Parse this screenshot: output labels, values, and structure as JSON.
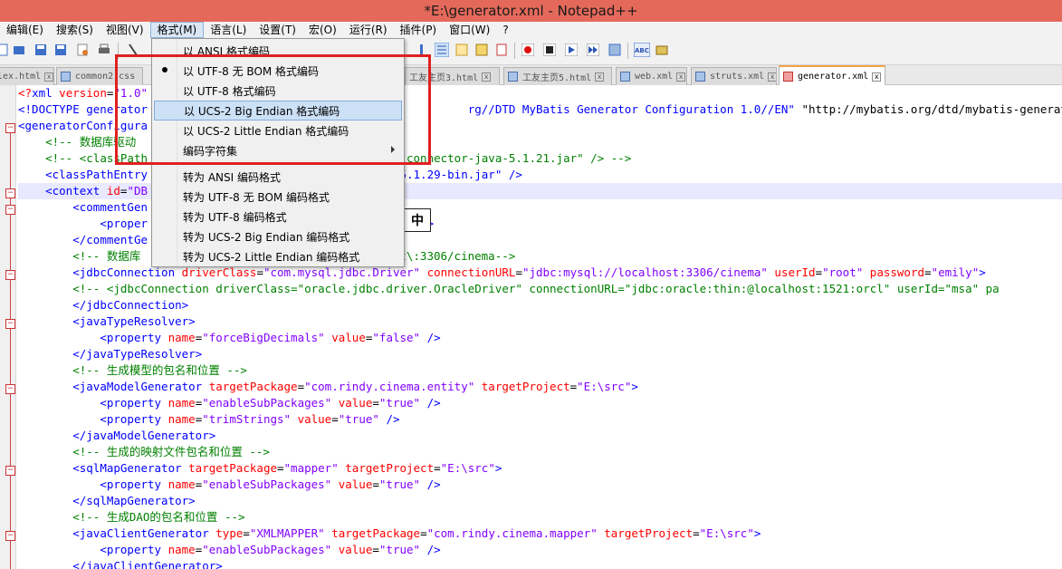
{
  "window": {
    "title": "*E:\\generator.xml - Notepad++"
  },
  "menubar": {
    "items": [
      "编辑(E)",
      "搜索(S)",
      "视图(V)",
      "格式(M)",
      "语言(L)",
      "设置(T)",
      "宏(O)",
      "运行(R)",
      "插件(P)",
      "窗口(W)",
      "?"
    ]
  },
  "tabs": [
    {
      "label": "lex.html",
      "active": false
    },
    {
      "label": "common2.css",
      "active": false
    },
    {
      "label": "工友主页3.html",
      "active": false
    },
    {
      "label": "工友主页5.html",
      "active": false
    },
    {
      "label": "web.xml",
      "active": false
    },
    {
      "label": "struts.xml",
      "active": false
    },
    {
      "label": "generator.xml",
      "active": true
    }
  ],
  "format_menu": {
    "items": [
      {
        "label": "以 ANSI 格式编码",
        "checked": false
      },
      {
        "label": "以 UTF-8 无 BOM 格式编码",
        "checked": true
      },
      {
        "label": "以 UTF-8 格式编码",
        "checked": false
      },
      {
        "label": "以 UCS-2 Big Endian 格式编码",
        "checked": false,
        "highlighted": true
      },
      {
        "label": "以 UCS-2 Little Endian 格式编码",
        "checked": false
      },
      {
        "label": "编码字符集",
        "submenu": true
      },
      {
        "label": "转为 ANSI 编码格式"
      },
      {
        "label": "转为 UTF-8 无 BOM 编码格式"
      },
      {
        "label": "转为 UTF-8 编码格式"
      },
      {
        "label": "转为 UCS-2 Big Endian 编码格式"
      },
      {
        "label": "转为 UCS-2 Little Endian 编码格式"
      }
    ]
  },
  "ime_indicator": "中",
  "code_lines": [
    [
      [
        "pi",
        "<?"
      ],
      [
        "tag",
        "xml "
      ],
      [
        "attr",
        "version"
      ],
      [
        "txt",
        "="
      ],
      [
        "val",
        "\"1.0\""
      ]
    ],
    [
      [
        "tag",
        "<!DOCTYPE generator"
      ],
      [
        "txt",
        "                                               "
      ],
      [
        "tag",
        "rg//DTD MyBatis Generator Configuration 1.0//EN\" "
      ],
      [
        "txt",
        "\"http://mybatis.org/dtd/mybatis-generator-"
      ]
    ],
    [
      [
        "tag",
        "<generatorConfigura"
      ]
    ],
    [
      [
        "txt",
        "    "
      ],
      [
        "cmt",
        "<!-- 数据库驱动"
      ]
    ],
    [
      [
        "txt",
        "    "
      ],
      [
        "cmt",
        "<!-- <classPath"
      ],
      [
        "txt",
        "                                    "
      ],
      [
        "cmt",
        "l-connector-java-5.1.21.jar\" /> -->"
      ]
    ],
    [
      [
        "txt",
        "    "
      ],
      [
        "tag",
        "<classPathEntry"
      ],
      [
        "txt",
        "                                    "
      ],
      [
        "tag",
        "-5.1.29-bin.jar\" />"
      ]
    ],
    [
      [
        "txt",
        "    "
      ],
      [
        "tag",
        "<context "
      ],
      [
        "attr",
        "id"
      ],
      [
        "txt",
        "="
      ],
      [
        "val",
        "\"DB"
      ]
    ],
    [
      [
        "txt",
        "        "
      ],
      [
        "tag",
        "<commentGen"
      ]
    ],
    [
      [
        "txt",
        "            "
      ],
      [
        "tag",
        "<proper"
      ],
      [
        "txt",
        "                                   "
      ],
      [
        "val",
        "rue\" "
      ],
      [
        "tag",
        "/>"
      ]
    ],
    [
      [
        "txt",
        "        "
      ],
      [
        "tag",
        "</commentGe"
      ]
    ],
    [
      [
        "txt",
        "        "
      ],
      [
        "cmt",
        "<!-- 数据库"
      ],
      [
        "txt",
        "                          "
      ],
      [
        "cmt",
        "\\://localhost\\:3306/cinema-->"
      ]
    ],
    [
      [
        "txt",
        "        "
      ],
      [
        "tag",
        "<jdbcConnection "
      ],
      [
        "attr",
        "driverClass"
      ],
      [
        "txt",
        "="
      ],
      [
        "val",
        "\"com.mysql.jdbc.Driver\" "
      ],
      [
        "attr",
        "connectionURL"
      ],
      [
        "txt",
        "="
      ],
      [
        "val",
        "\"jdbc:mysql://localhost:3306/cinema\" "
      ],
      [
        "attr",
        "userId"
      ],
      [
        "txt",
        "="
      ],
      [
        "val",
        "\"root\" "
      ],
      [
        "attr",
        "password"
      ],
      [
        "txt",
        "="
      ],
      [
        "val",
        "\"emily\""
      ],
      [
        "tag",
        ">"
      ]
    ],
    [
      [
        "txt",
        "        "
      ],
      [
        "cmt",
        "<!-- <jdbcConnection driverClass=\"oracle.jdbc.driver.OracleDriver\" connectionURL=\"jdbc:oracle:thin:@localhost:1521:orcl\" userId=\"msa\" pa"
      ]
    ],
    [
      [
        "txt",
        "        "
      ],
      [
        "tag",
        "</jdbcConnection>"
      ]
    ],
    [
      [
        "txt",
        "        "
      ],
      [
        "tag",
        "<javaTypeResolver>"
      ]
    ],
    [
      [
        "txt",
        "            "
      ],
      [
        "tag",
        "<property "
      ],
      [
        "attr",
        "name"
      ],
      [
        "txt",
        "="
      ],
      [
        "val",
        "\"forceBigDecimals\" "
      ],
      [
        "attr",
        "value"
      ],
      [
        "txt",
        "="
      ],
      [
        "val",
        "\"false\" "
      ],
      [
        "tag",
        "/>"
      ]
    ],
    [
      [
        "txt",
        "        "
      ],
      [
        "tag",
        "</javaTypeResolver>"
      ]
    ],
    [
      [
        "txt",
        "        "
      ],
      [
        "cmt",
        "<!-- 生成模型的包名和位置 -->"
      ]
    ],
    [
      [
        "txt",
        "        "
      ],
      [
        "tag",
        "<javaModelGenerator "
      ],
      [
        "attr",
        "targetPackage"
      ],
      [
        "txt",
        "="
      ],
      [
        "val",
        "\"com.rindy.cinema.entity\" "
      ],
      [
        "attr",
        "targetProject"
      ],
      [
        "txt",
        "="
      ],
      [
        "val",
        "\"E:\\src\""
      ],
      [
        "tag",
        ">"
      ]
    ],
    [
      [
        "txt",
        "            "
      ],
      [
        "tag",
        "<property "
      ],
      [
        "attr",
        "name"
      ],
      [
        "txt",
        "="
      ],
      [
        "val",
        "\"enableSubPackages\" "
      ],
      [
        "attr",
        "value"
      ],
      [
        "txt",
        "="
      ],
      [
        "val",
        "\"true\" "
      ],
      [
        "tag",
        "/>"
      ]
    ],
    [
      [
        "txt",
        "            "
      ],
      [
        "tag",
        "<property "
      ],
      [
        "attr",
        "name"
      ],
      [
        "txt",
        "="
      ],
      [
        "val",
        "\"trimStrings\" "
      ],
      [
        "attr",
        "value"
      ],
      [
        "txt",
        "="
      ],
      [
        "val",
        "\"true\" "
      ],
      [
        "tag",
        "/>"
      ]
    ],
    [
      [
        "txt",
        "        "
      ],
      [
        "tag",
        "</javaModelGenerator>"
      ]
    ],
    [
      [
        "txt",
        "        "
      ],
      [
        "cmt",
        "<!-- 生成的映射文件包名和位置 -->"
      ]
    ],
    [
      [
        "txt",
        "        "
      ],
      [
        "tag",
        "<sqlMapGenerator "
      ],
      [
        "attr",
        "targetPackage"
      ],
      [
        "txt",
        "="
      ],
      [
        "val",
        "\"mapper\" "
      ],
      [
        "attr",
        "targetProject"
      ],
      [
        "txt",
        "="
      ],
      [
        "val",
        "\"E:\\src\""
      ],
      [
        "tag",
        ">"
      ]
    ],
    [
      [
        "txt",
        "            "
      ],
      [
        "tag",
        "<property "
      ],
      [
        "attr",
        "name"
      ],
      [
        "txt",
        "="
      ],
      [
        "val",
        "\"enableSubPackages\" "
      ],
      [
        "attr",
        "value"
      ],
      [
        "txt",
        "="
      ],
      [
        "val",
        "\"true\" "
      ],
      [
        "tag",
        "/>"
      ]
    ],
    [
      [
        "txt",
        "        "
      ],
      [
        "tag",
        "</sqlMapGenerator>"
      ]
    ],
    [
      [
        "txt",
        "        "
      ],
      [
        "cmt",
        "<!-- 生成DAO的包名和位置 -->"
      ]
    ],
    [
      [
        "txt",
        "        "
      ],
      [
        "tag",
        "<javaClientGenerator "
      ],
      [
        "attr",
        "type"
      ],
      [
        "txt",
        "="
      ],
      [
        "val",
        "\"XMLMAPPER\" "
      ],
      [
        "attr",
        "targetPackage"
      ],
      [
        "txt",
        "="
      ],
      [
        "val",
        "\"com.rindy.cinema.mapper\" "
      ],
      [
        "attr",
        "targetProject"
      ],
      [
        "txt",
        "="
      ],
      [
        "val",
        "\"E:\\src\""
      ],
      [
        "tag",
        ">"
      ]
    ],
    [
      [
        "txt",
        "            "
      ],
      [
        "tag",
        "<property "
      ],
      [
        "attr",
        "name"
      ],
      [
        "txt",
        "="
      ],
      [
        "val",
        "\"enableSubPackages\" "
      ],
      [
        "attr",
        "value"
      ],
      [
        "txt",
        "="
      ],
      [
        "val",
        "\"true\" "
      ],
      [
        "tag",
        "/>"
      ]
    ],
    [
      [
        "txt",
        "        "
      ],
      [
        "tag",
        "</javaClientGenerator>"
      ]
    ]
  ]
}
